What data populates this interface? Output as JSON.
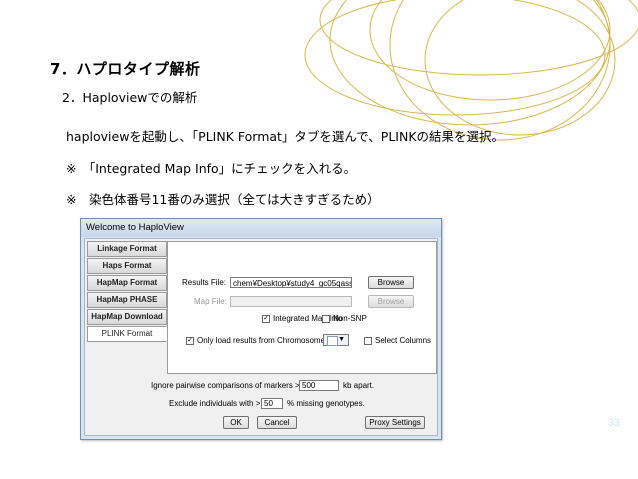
{
  "slide": {
    "title": "7．ハプロタイプ解析",
    "subtitle": "2．Haploviewでの解析",
    "lines": [
      "haploviewを起動し、「PLINK Format」タブを選んで、PLINKの結果を選択。",
      "※　「Integrated Map Info」にチェックを入れる。",
      "※　染色体番号11番のみ選択（全ては大きすぎるため）"
    ],
    "page_number": "33"
  },
  "dialog": {
    "title": "Welcome to HaploView",
    "tabs": [
      "Linkage Format",
      "Haps Format",
      "HapMap Format",
      "HapMap PHASE",
      "HapMap Download",
      "PLINK Format"
    ],
    "active_tab_index": 5,
    "results_file_label": "Results File:",
    "results_file_value": "chem¥Desktop¥study4_gc05qassoc",
    "map_file_label": "Map File:",
    "map_file_value": "",
    "browse_label": "Browse",
    "integrated_map_label": "Integrated Map Info",
    "integrated_map_checked": true,
    "non_snp_label": "Non-SNP",
    "non_snp_checked": false,
    "only_load_label": "Only load results from Chromosome",
    "only_load_checked": true,
    "select_columns_label": "Select Columns",
    "select_columns_checked": false,
    "ignore_label": "Ignore pairwise comparisons of markers >",
    "ignore_value": "500",
    "ignore_unit": "kb apart.",
    "exclude_label": "Exclude individuals with >",
    "exclude_value": "50",
    "exclude_unit": "% missing genotypes.",
    "ok_label": "OK",
    "cancel_label": "Cancel",
    "proxy_label": "Proxy Settings"
  },
  "colors": {
    "dialog_border": "#6f8fb3",
    "ring_gold": "#d6b84a"
  }
}
